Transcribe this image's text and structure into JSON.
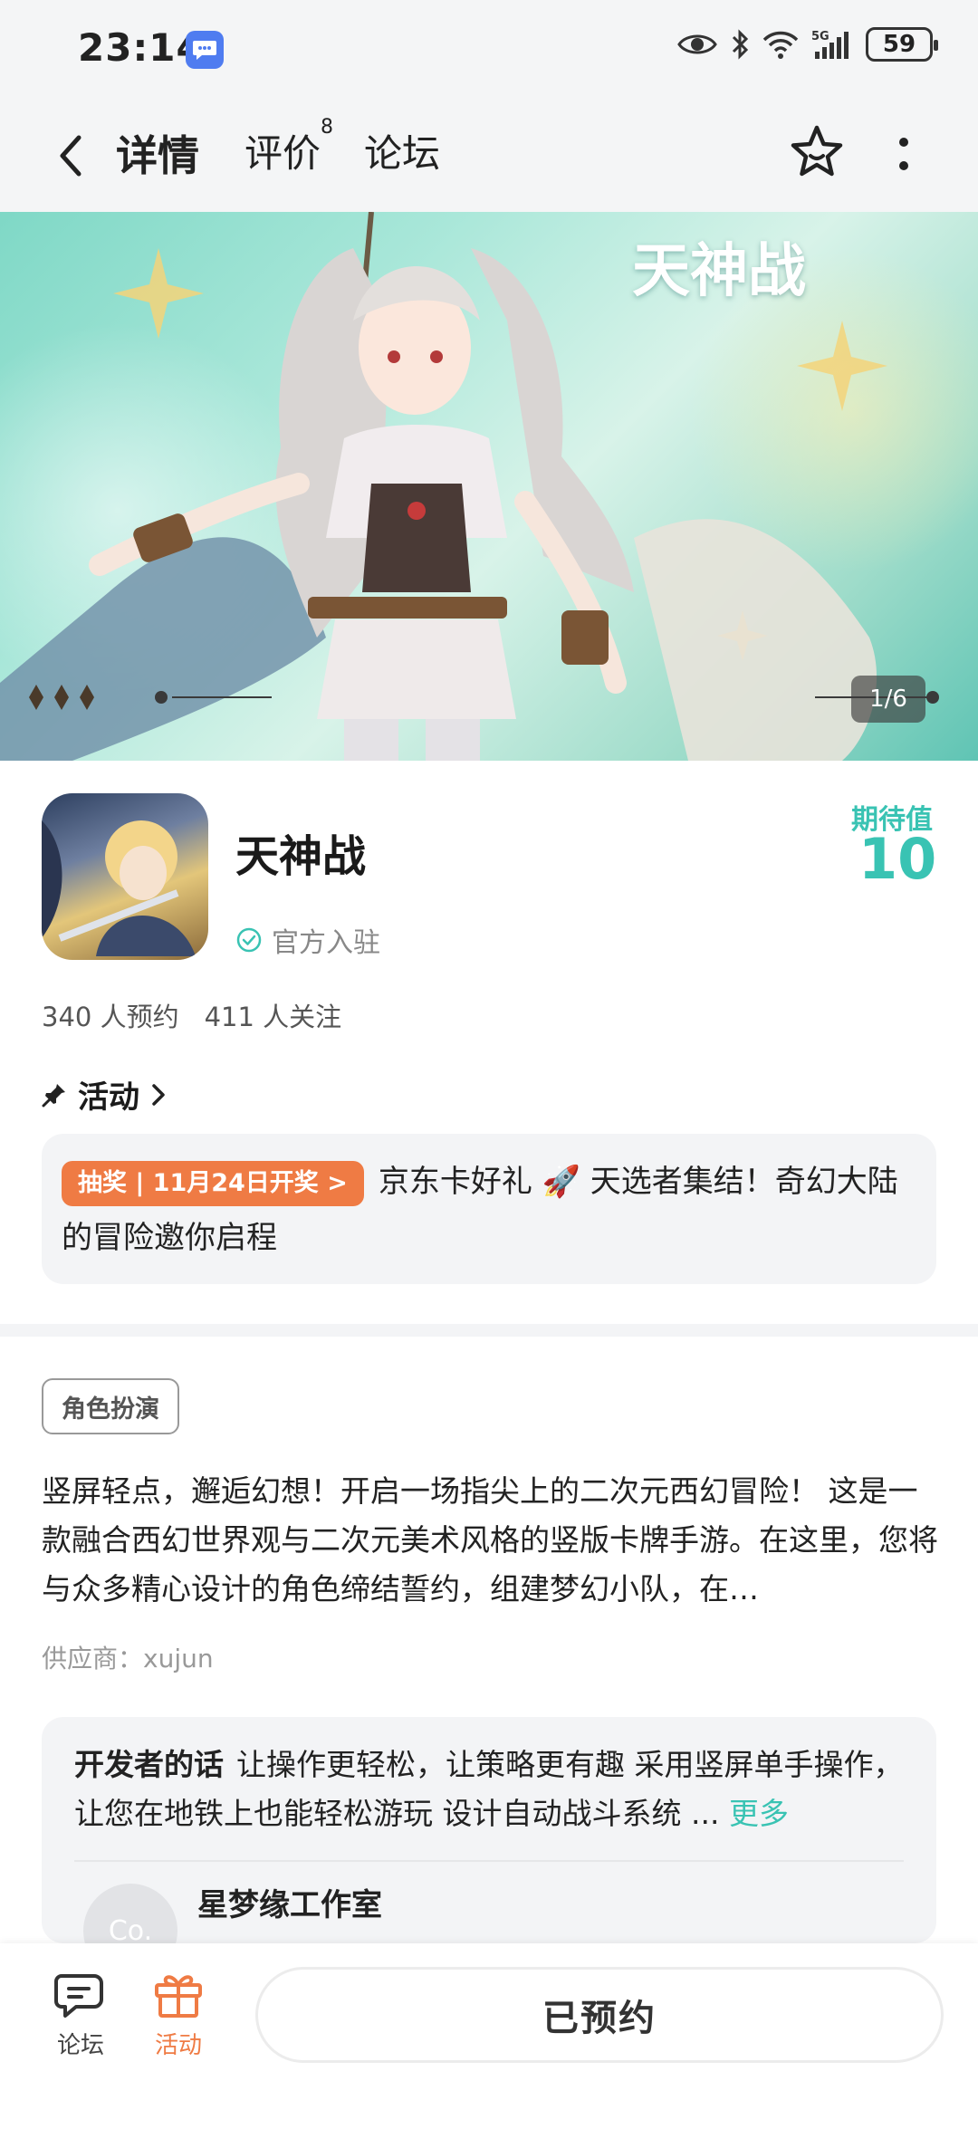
{
  "status": {
    "time": "23:14",
    "battery": "59"
  },
  "nav": {
    "tabs": [
      {
        "label": "详情",
        "active": true
      },
      {
        "label": "评价",
        "count": "8"
      },
      {
        "label": "论坛"
      }
    ]
  },
  "banner": {
    "logo_text": "天神战",
    "counter": "1/6"
  },
  "app": {
    "name": "天神战",
    "official_label": "官方入驻",
    "expect_label": "期待值",
    "expect_value": "10",
    "reservations": "340 人预约",
    "followers": "411 人关注"
  },
  "activity": {
    "title": "活动",
    "tag": "抽奖 | 11月24日开奖 >",
    "text": "京东卡好礼 🚀 天选者集结！奇幻大陆的冒险邀你启程"
  },
  "details": {
    "genre": "角色扮演",
    "description": "竖屏轻点，邂逅幻想！开启一场指尖上的二次元西幻冒险！ 这是一款融合西幻世界观与二次元美术风格的竖版卡牌手游。在这里，您将与众多精心设计的角色缔结誓约，组建梦幻小队，在…",
    "supplier": "供应商：xujun"
  },
  "developer": {
    "label": "开发者的话",
    "text": "让操作更轻松，让策略更有趣 采用竖屏单手操作，让您在地铁上也能轻松游玩 设计自动战斗系统 ...",
    "more": "更多",
    "avatar_text": "Co.",
    "studio": "星梦缘工作室"
  },
  "bottom": {
    "forum_label": "论坛",
    "activity_label": "活动",
    "reserve_label": "已预约"
  },
  "colors": {
    "accent": "#39c3b3",
    "orange": "#ef7b44"
  }
}
